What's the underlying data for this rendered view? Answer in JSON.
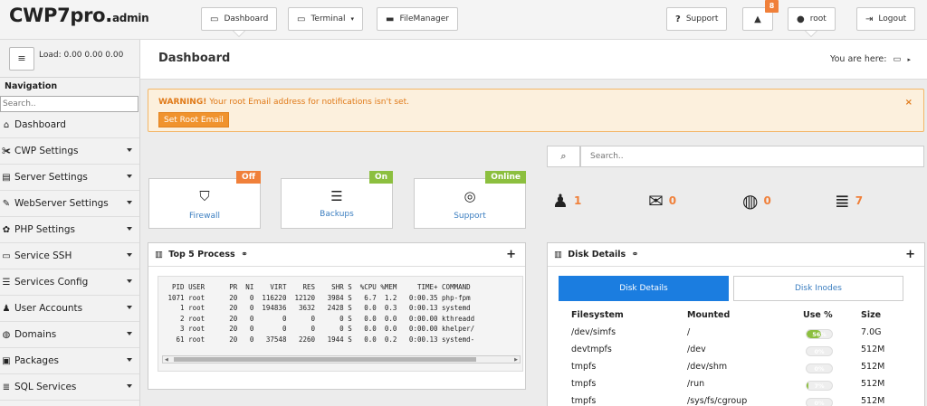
{
  "app": {
    "logo_main": "CWP7pro.",
    "logo_sub": "admin"
  },
  "topnav": {
    "dashboard": "Dashboard",
    "terminal": "Terminal",
    "filemanager": "FileManager",
    "support": "Support",
    "notifications_count": "8",
    "user": "root",
    "logout": "Logout"
  },
  "sidebar": {
    "load_label": "Load: 0.00  0.00  0.00",
    "nav_title": "Navigation",
    "search_placeholder": "Search..",
    "items": [
      {
        "label": "Dashboard",
        "icon": "home-icon",
        "caret": false
      },
      {
        "label": "CWP Settings",
        "icon": "wrench-icon",
        "caret": true
      },
      {
        "label": "Server Settings",
        "icon": "server-icon",
        "caret": true
      },
      {
        "label": "WebServer Settings",
        "icon": "pencil-icon",
        "caret": true
      },
      {
        "label": "PHP Settings",
        "icon": "cog-icon",
        "caret": true
      },
      {
        "label": "Service SSH",
        "icon": "monitor-icon",
        "caret": true
      },
      {
        "label": "Services Config",
        "icon": "list-icon",
        "caret": true
      },
      {
        "label": "User Accounts",
        "icon": "user-icon",
        "caret": true
      },
      {
        "label": "Domains",
        "icon": "globe-icon",
        "caret": true
      },
      {
        "label": "Packages",
        "icon": "box-icon",
        "caret": true
      },
      {
        "label": "SQL Services",
        "icon": "database-icon",
        "caret": true
      }
    ]
  },
  "page": {
    "title": "Dashboard",
    "you_are_here": "You are here:"
  },
  "warning": {
    "strong": "WARNING!",
    "text": " Your root Email address for notifications isn't set.",
    "button": "Set Root Email",
    "close": "×"
  },
  "search": {
    "placeholder": "Search.."
  },
  "status_boxes": [
    {
      "label": "Firewall",
      "badge": "Off",
      "badge_color": "#f0803a",
      "icon": "shield-icon"
    },
    {
      "label": "Backups",
      "badge": "On",
      "badge_color": "#8cbf3f",
      "icon": "archive-icon"
    },
    {
      "label": "Support",
      "badge": "Online",
      "badge_color": "#8cbf3f",
      "icon": "lifebuoy-icon"
    }
  ],
  "counters": [
    {
      "icon": "users-icon",
      "value": "1"
    },
    {
      "icon": "envelope-icon",
      "value": "0"
    },
    {
      "icon": "globe-icon",
      "value": "0"
    },
    {
      "icon": "database-icon",
      "value": "7"
    }
  ],
  "top_process": {
    "title": "Top 5 Process",
    "header": "  PID USER      PR  NI    VIRT    RES    SHR S  %CPU %MEM     TIME+ COMMAND",
    "rows": [
      " 1071 root      20   0  116220  12120   3984 S   6.7  1.2   0:00.35 php-fpm",
      "    1 root      20   0  194836   3632   2428 S   0.0  0.3   0:00.13 systemd",
      "    2 root      20   0       0      0      0 S   0.0  0.0   0:00.00 kthreadd",
      "    3 root      20   0       0      0      0 S   0.0  0.0   0:00.00 khelper/",
      "   61 root      20   0   37548   2260   1944 S   0.0  0.2   0:00.13 systemd-"
    ]
  },
  "disk": {
    "title": "Disk Details",
    "tab_details": "Disk Details",
    "tab_inodes": "Disk Inodes",
    "headers": {
      "fs": "Filesystem",
      "mounted": "Mounted",
      "use": "Use %",
      "size": "Size"
    },
    "rows": [
      {
        "fs": "/dev/simfs",
        "mounted": "/",
        "use": 56,
        "use_label": "56%",
        "size": "7.0G"
      },
      {
        "fs": "devtmpfs",
        "mounted": "/dev",
        "use": 0,
        "use_label": "0%",
        "size": "512M"
      },
      {
        "fs": "tmpfs",
        "mounted": "/dev/shm",
        "use": 0,
        "use_label": "0%",
        "size": "512M"
      },
      {
        "fs": "tmpfs",
        "mounted": "/run",
        "use": 7,
        "use_label": "7%",
        "size": "512M"
      },
      {
        "fs": "tmpfs",
        "mounted": "/sys/fs/cgroup",
        "use": 0,
        "use_label": "0%",
        "size": "512M"
      }
    ]
  }
}
